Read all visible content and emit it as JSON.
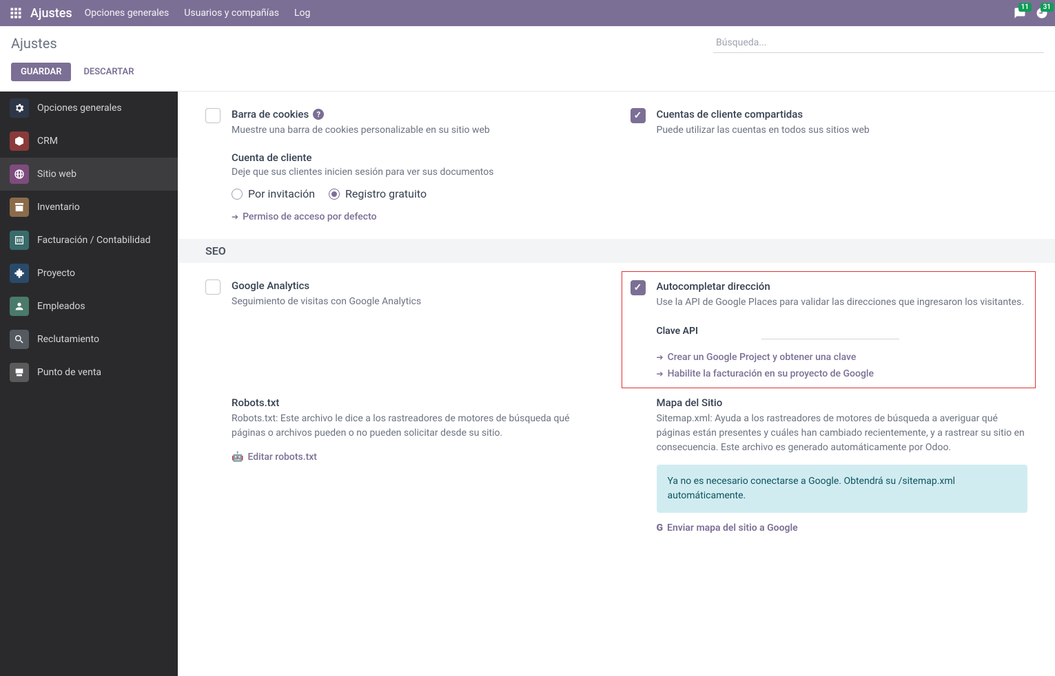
{
  "topnav": {
    "brand": "Ajustes",
    "items": [
      "Opciones generales",
      "Usuarios y compañías",
      "Log"
    ],
    "chat_count": "11",
    "clock_count": "31"
  },
  "cp": {
    "title": "Ajustes",
    "search_placeholder": "Búsqueda...",
    "save": "GUARDAR",
    "discard": "DESCARTAR"
  },
  "sidebar": {
    "items": [
      {
        "label": "Opciones generales",
        "cls": "gear"
      },
      {
        "label": "CRM",
        "cls": "crm"
      },
      {
        "label": "Sitio web",
        "cls": "web",
        "active": true
      },
      {
        "label": "Inventario",
        "cls": "inv"
      },
      {
        "label": "Facturación / Contabilidad",
        "cls": "acc"
      },
      {
        "label": "Proyecto",
        "cls": "proj"
      },
      {
        "label": "Empleados",
        "cls": "emp"
      },
      {
        "label": "Reclutamiento",
        "cls": "rec"
      },
      {
        "label": "Punto de venta",
        "cls": "pos"
      }
    ]
  },
  "r1": {
    "cookies_title": "Barra de cookies",
    "cookies_desc": "Muestre una barra de cookies personalizable en su sitio web",
    "account_title": "Cuenta de cliente",
    "account_desc": "Deje que sus clientes inicien sesión para ver sus documentos",
    "radio_invite": "Por invitación",
    "radio_free": "Registro gratuito",
    "default_access": "Permiso de acceso por defecto",
    "shared_title": "Cuentas de cliente compartidas",
    "shared_desc": "Puede utilizar las cuentas en todos sus sitios web"
  },
  "seo": {
    "header": "SEO",
    "ga_title": "Google Analytics",
    "ga_desc": "Seguimiento de visitas con Google Analytics",
    "ac_title": "Autocompletar dirección",
    "ac_desc": "Use la API de Google Places para validar las direcciones que ingresaron los visitantes.",
    "api_label": "Clave API",
    "link1": "Crear un Google Project y obtener una clave",
    "link2": "Habilite la facturación en su proyecto de Google",
    "robots_title": "Robots.txt",
    "robots_desc": "Robots.txt: Este archivo le dice a los rastreadores de motores de búsqueda qué páginas o archivos pueden o no pueden solicitar desde su sitio.",
    "robots_edit": "Editar robots.txt",
    "sitemap_title": "Mapa del Sitio",
    "sitemap_desc": "Sitemap.xml: Ayuda a los rastreadores de motores de búsqueda a averiguar qué páginas están presentes y cuáles han cambiado recientemente, y a rastrear su sitio en consecuencia. Este archivo es generado automáticamente por Odoo.",
    "sitemap_info": "Ya no es necesario conectarse a Google. Obtendrá su /sitemap.xml automáticamente.",
    "sitemap_send": "Enviar mapa del sitio a Google"
  }
}
